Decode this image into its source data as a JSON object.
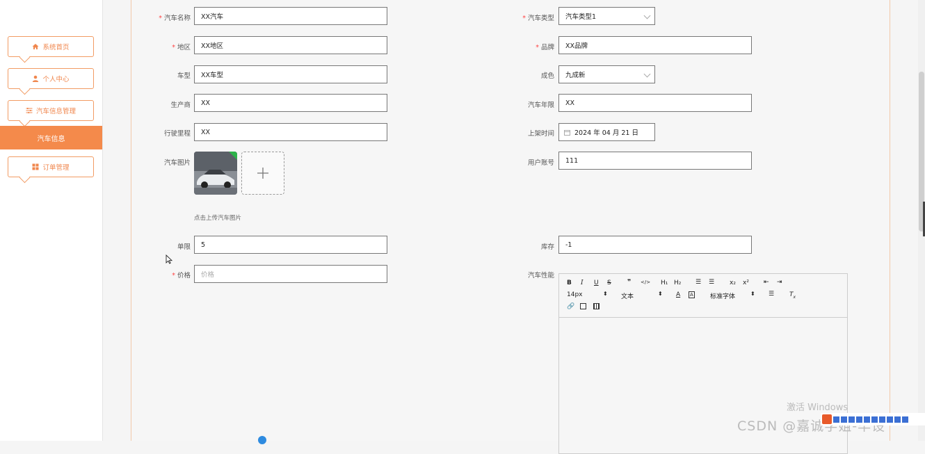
{
  "sidebar": {
    "items": [
      {
        "label": "系统首页",
        "icon": "home-icon"
      },
      {
        "label": "个人中心",
        "icon": "user-icon"
      },
      {
        "label": "汽车信息管理",
        "icon": "sliders-icon"
      },
      {
        "label": "订单管理",
        "icon": "grid-icon"
      }
    ],
    "active_subitem": "汽车信息"
  },
  "form": {
    "car_name": {
      "label": "汽车名称",
      "value": "XX汽车"
    },
    "car_type": {
      "label": "汽车类型",
      "value": "汽车类型1"
    },
    "region": {
      "label": "地区",
      "value": "XX地区"
    },
    "brand": {
      "label": "品牌",
      "value": "XX品牌"
    },
    "model": {
      "label": "车型",
      "value": "XX车型"
    },
    "condition": {
      "label": "成色",
      "value": "九成新"
    },
    "manufacturer": {
      "label": "生产商",
      "value": "XX"
    },
    "car_years": {
      "label": "汽车年限",
      "value": "XX"
    },
    "mileage": {
      "label": "行驶里程",
      "value": "XX"
    },
    "listing_time": {
      "label": "上架时间",
      "value": "2024 年 04 月 21 日"
    },
    "car_image": {
      "label": "汽车图片",
      "hint": "点击上传汽车图片"
    },
    "user_account": {
      "label": "用户账号",
      "value": "111"
    },
    "limit": {
      "label": "单限",
      "value": "5"
    },
    "stock": {
      "label": "库存",
      "value": "-1"
    },
    "price": {
      "label": "价格",
      "placeholder": "价格"
    },
    "performance": {
      "label": "汽车性能"
    }
  },
  "editor": {
    "font_size": "14px",
    "text_type": "文本",
    "font_family": "标准字体"
  },
  "overlay": {
    "activate_text": "激活 Windows",
    "watermark": "CSDN @嘉诚学姐-毕设"
  },
  "colors": {
    "accent": "#f48a4b",
    "required": "#ff4444"
  }
}
